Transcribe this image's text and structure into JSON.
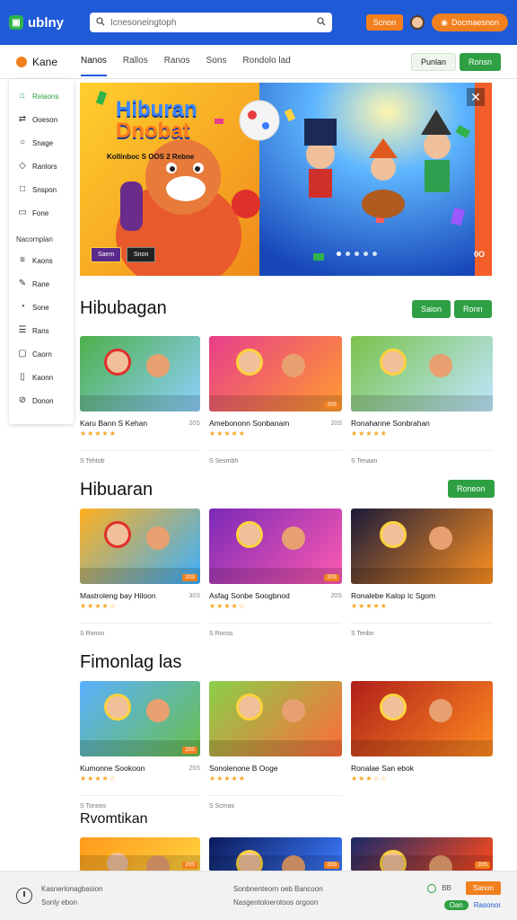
{
  "topbar": {
    "logo_text": "ublny",
    "search_placeholder": "Icnesoneingtoph",
    "btn_login": "Scnon",
    "btn_register": "Docmaesnon"
  },
  "subnav": {
    "brand": "Kane",
    "tabs": [
      "Nanos",
      "Rallos",
      "Ranos",
      "Sons",
      "Rondolo lad"
    ],
    "btn_secondary": "Punlan",
    "btn_primary": "Ronsn"
  },
  "sidebar": {
    "items": [
      {
        "label": "Relaons",
        "icon": "home-icon"
      },
      {
        "label": "Ooeson",
        "icon": "shuffle-icon"
      },
      {
        "label": "Snage",
        "icon": "circle-icon"
      },
      {
        "label": "Ranlors",
        "icon": "cube-icon"
      },
      {
        "label": "Snspon",
        "icon": "square-icon"
      },
      {
        "label": "Fone",
        "icon": "doc-icon"
      }
    ],
    "section_label": "Nacornplan",
    "items2": [
      {
        "label": "Kaons",
        "icon": "layers-icon"
      },
      {
        "label": "Rane",
        "icon": "pen-icon"
      },
      {
        "label": "Sone",
        "icon": "pie-icon"
      },
      {
        "label": "Rans",
        "icon": "list-icon"
      },
      {
        "label": "Caorn",
        "icon": "box-icon"
      },
      {
        "label": "Kaonn",
        "icon": "file-icon"
      },
      {
        "label": "Donon",
        "icon": "link-icon"
      }
    ]
  },
  "hero": {
    "title_line1": "Hiburan",
    "title_line2": "Dnobat",
    "subtitle": "Kollinboc S OOS 2 Rebne",
    "btn1": "Saem",
    "btn2": "Snon",
    "counter": "0O",
    "slides": 5
  },
  "sections": [
    {
      "title": "Hibubagan",
      "btn1": "Saion",
      "btn2": "Ronn",
      "cards": [
        {
          "title": "Karu Bann S Kehan",
          "meta": "20S",
          "stars": "★★★★★",
          "foot": "S Tehtob",
          "img": "hat-boy",
          "badge": ""
        },
        {
          "title": "Amebononn Sonbanam",
          "meta": "20S",
          "stars": "★★★★★",
          "foot": "S Sesmbh",
          "img": "bear",
          "badge": "20S"
        },
        {
          "title": "Ronahanne Sonbrahan",
          "meta": "",
          "stars": "★★★★★",
          "foot": "S Tenaan",
          "img": "hunger",
          "badge": ""
        }
      ]
    },
    {
      "title": "Hibuaran",
      "btn1": "Roneon",
      "btn2": "",
      "cards": [
        {
          "title": "Mastroleng bay Hiloon",
          "meta": "30S",
          "stars": "★★★★☆",
          "foot": "S Ronon",
          "img": "animals",
          "badge": "20S"
        },
        {
          "title": "Asfag Sonbe Soogbnod",
          "meta": "20S",
          "stars": "★★★★☆",
          "foot": "S Ronss",
          "img": "babes",
          "badge": "20S"
        },
        {
          "title": "Ronalebe Kalop Ic Sgom",
          "meta": "",
          "stars": "★★★★★",
          "foot": "S Tenbn",
          "img": "show",
          "badge": ""
        }
      ]
    },
    {
      "title": "Fimonlag las",
      "btn1": "",
      "btn2": "",
      "cards": [
        {
          "title": "Kumonne Sookoon",
          "meta": "20S",
          "stars": "★★★★☆",
          "foot": "S Tonoos",
          "img": "sanads",
          "badge": "20S"
        },
        {
          "title": "Sonolenone B Ooge",
          "meta": "",
          "stars": "★★★★★",
          "foot": "S Scmas",
          "img": "balloon",
          "badge": ""
        },
        {
          "title": "Ronalae San ebok",
          "meta": "",
          "stars": "★★★☆☆",
          "foot": "",
          "img": "nanes",
          "badge": ""
        }
      ]
    },
    {
      "title": "Rvomtikan",
      "btn1": "",
      "btn2": "",
      "cards": [
        {
          "title": "",
          "meta": "",
          "stars": "",
          "foot": "",
          "img": "smile",
          "badge": "20S"
        },
        {
          "title": "",
          "meta": "",
          "stars": "",
          "foot": "",
          "img": "space",
          "badge": "20S"
        },
        {
          "title": "",
          "meta": "",
          "stars": "",
          "foot": "",
          "img": "fire",
          "badge": "20S"
        }
      ]
    }
  ],
  "footer": {
    "line1": "Kasnerlonagbasion",
    "line2": "Sonly ebon",
    "mid1": "Sonbnenteorn oeb Bancoon",
    "mid2": "Nasgentoloerotoos orgoon",
    "count": "BB",
    "btn_orange": "Sanon",
    "link_label": "Rasonor",
    "toggle_label": "Oan"
  },
  "colors": {
    "topbar": "#1f5bd6",
    "accent_green": "#2ea043",
    "accent_orange": "#f2801e"
  }
}
